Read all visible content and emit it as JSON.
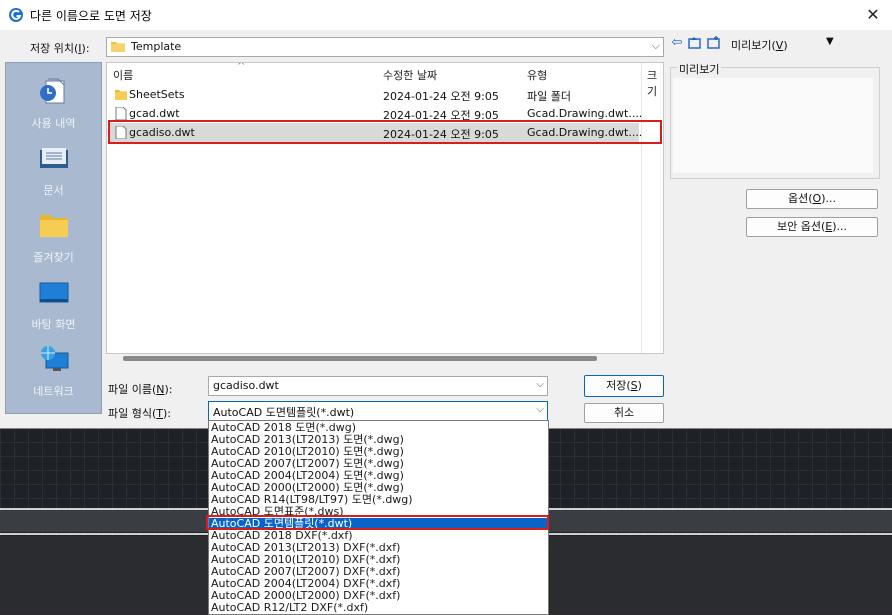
{
  "window": {
    "title": "다른 이름으로 도면 저장",
    "close": "✕"
  },
  "location": {
    "label": "저장 위치(I):",
    "value": "Template"
  },
  "toolbar": {
    "view_menu": "미리보기(V)",
    "view_arrow": "▼"
  },
  "places": [
    {
      "label": "사용 내역",
      "icon": "history-icon"
    },
    {
      "label": "문서",
      "icon": "documents-icon"
    },
    {
      "label": "즐겨찾기",
      "icon": "favorites-folder-icon"
    },
    {
      "label": "바탕 화면",
      "icon": "desktop-icon"
    },
    {
      "label": "네트워크",
      "icon": "network-icon"
    }
  ],
  "columns": {
    "name": "이름",
    "modified": "수정한 날짜",
    "type": "유형",
    "size": "크기"
  },
  "files": [
    {
      "name": "SheetSets",
      "modified": "2024-01-24 오전 9:05",
      "type": "파일 폴더",
      "icon": "folder-icon"
    },
    {
      "name": "gcad.dwt",
      "modified": "2024-01-24 오전 9:05",
      "type": "Gcad.Drawing.dwt....",
      "icon": "file-icon"
    },
    {
      "name": "gcadiso.dwt",
      "modified": "2024-01-24 오전 9:05",
      "type": "Gcad.Drawing.dwt....",
      "icon": "file-icon"
    }
  ],
  "preview": {
    "label": "미리보기"
  },
  "buttons": {
    "options": "옵션(O)...",
    "security": "보안 옵션(E)...",
    "save": "저장(S)",
    "cancel": "취소"
  },
  "filename": {
    "label": "파일 이름(N):",
    "value": "gcadiso.dwt"
  },
  "filetype": {
    "label": "파일 형식(T):",
    "value": "AutoCAD 도면템플릿(*.dwt)",
    "options": [
      "AutoCAD 2018 도면(*.dwg)",
      "AutoCAD 2013(LT2013) 도면(*.dwg)",
      "AutoCAD 2010(LT2010) 도면(*.dwg)",
      "AutoCAD 2007(LT2007) 도면(*.dwg)",
      "AutoCAD 2004(LT2004) 도면(*.dwg)",
      "AutoCAD 2000(LT2000) 도면(*.dwg)",
      "AutoCAD R14(LT98/LT97) 도면(*.dwg)",
      "AutoCAD 도면표준(*.dws)",
      "AutoCAD 도면템플릿(*.dwt)",
      "AutoCAD 2018 DXF(*.dxf)",
      "AutoCAD 2013(LT2013) DXF(*.dxf)",
      "AutoCAD 2010(LT2010) DXF(*.dxf)",
      "AutoCAD 2007(LT2007) DXF(*.dxf)",
      "AutoCAD 2004(LT2004) DXF(*.dxf)",
      "AutoCAD 2000(LT2000) DXF(*.dxf)",
      "AutoCAD R12/LT2 DXF(*.dxf)"
    ],
    "highlighted_index": 8
  },
  "colors": {
    "accent": "#0a64c8",
    "highlight_box": "#d91c1c",
    "places_bg": "#a9b9cf"
  }
}
